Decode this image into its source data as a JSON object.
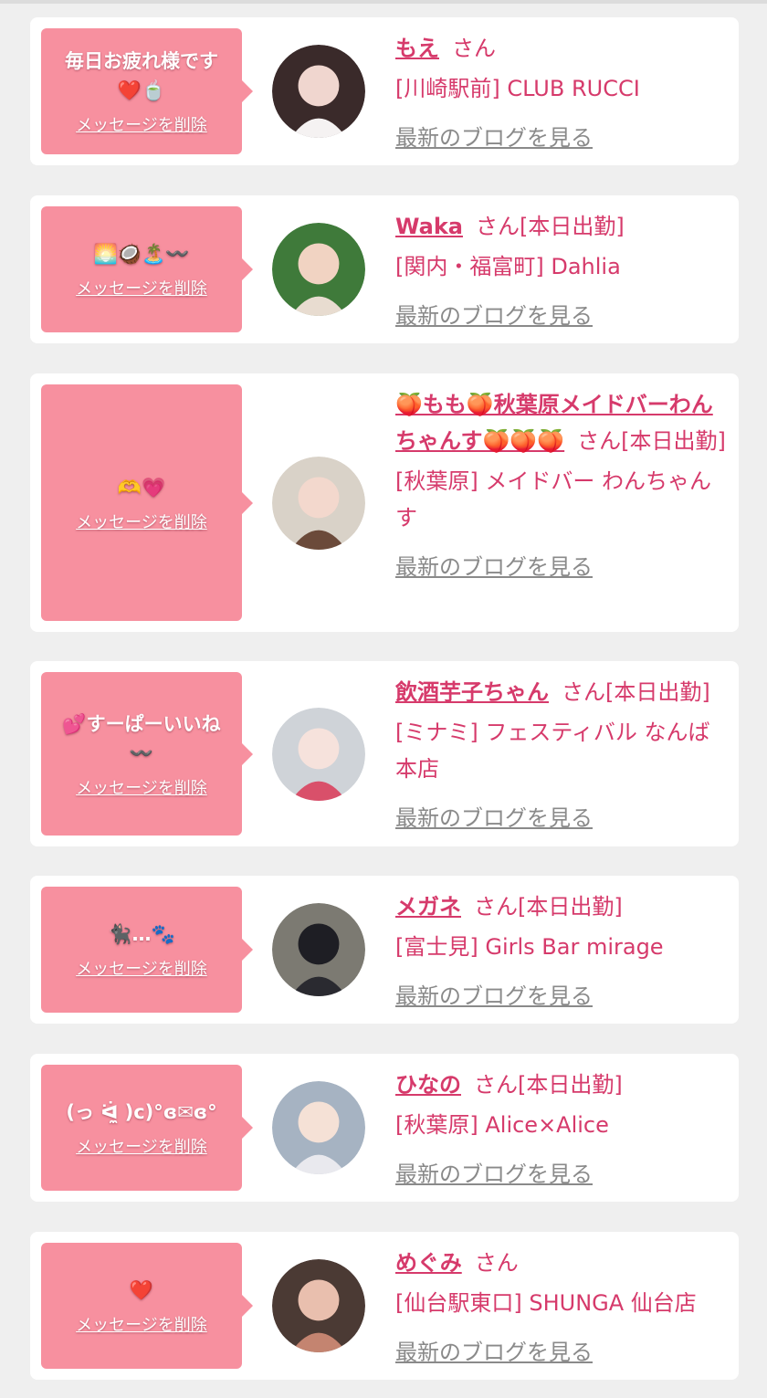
{
  "delete_label": "メッセージを削除",
  "blog_label": "最新のブログを見る",
  "honorific": "さん",
  "colors": {
    "bubble": "#f7909f",
    "accent": "#d63a6b",
    "muted": "#8a8a8a",
    "page": "#efefef",
    "card": "#ffffff"
  },
  "cards": [
    {
      "message": "毎日お疲れ様です\n❤️🍵",
      "name": "もえ",
      "attendance": "",
      "shop": "[川崎駅前] CLUB RUCCI",
      "avatar_icon": "profile-photo-icon"
    },
    {
      "message": "🌅🥥🏝️〰️",
      "name": "Waka",
      "attendance": "[本日出勤]",
      "shop": "[関内・福富町] Dahlia",
      "avatar_icon": "profile-photo-icon"
    },
    {
      "message": "🫶💗",
      "name": "🍑もも🍑秋葉原メイドバーわんちゃんす🍑🍑🍑",
      "attendance": "[本日出勤]",
      "shop": "[秋葉原] メイドバー わんちゃんす",
      "avatar_icon": "profile-photo-icon"
    },
    {
      "message": "💕すーぱーいいね\n〰️",
      "name": "飲酒芋子ちゃん",
      "attendance": "[本日出勤]",
      "shop": "[ミナミ] フェスティバル なんば本店",
      "avatar_icon": "profile-photo-icon"
    },
    {
      "message": "🐈‍⬛…🐾",
      "name": "メガネ",
      "attendance": "[本日出勤]",
      "shop": "[富士見] Girls Bar mirage",
      "avatar_icon": "profile-photo-icon"
    },
    {
      "message": "(っ ᐛ̼ )c)°ɞ✉ɞ°",
      "name": "ひなの",
      "attendance": "[本日出勤]",
      "shop": "[秋葉原] Alice×Alice",
      "avatar_icon": "profile-photo-icon"
    },
    {
      "message": "❤️",
      "name": "めぐみ",
      "attendance": "",
      "shop": "[仙台駅東口] SHUNGA 仙台店",
      "avatar_icon": "profile-photo-icon"
    }
  ]
}
